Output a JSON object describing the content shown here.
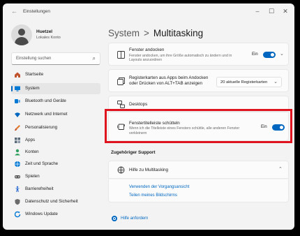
{
  "window": {
    "app_title": "Einstellungen",
    "back_icon": "arrow-left",
    "minimize_icon": "minimize",
    "maximize_icon": "maximize",
    "close_icon": "close"
  },
  "profile": {
    "name": "Huetzel",
    "account_type": "Lokales Konto"
  },
  "search": {
    "placeholder": "Einstellung suchen",
    "icon": "search"
  },
  "sidebar": {
    "items": [
      {
        "label": "Startseite",
        "icon": "home",
        "color": "#c0522d"
      },
      {
        "label": "System",
        "icon": "monitor",
        "color": "#0078d4",
        "selected": true
      },
      {
        "label": "Bluetooth und Geräte",
        "icon": "bluetooth",
        "color": "#0078d4"
      },
      {
        "label": "Netzwerk und Internet",
        "icon": "wifi",
        "color": "#0067c0"
      },
      {
        "label": "Personalisierung",
        "icon": "brush",
        "color": "#e07a2e"
      },
      {
        "label": "Apps",
        "icon": "apps",
        "color": "#5a6a7a"
      },
      {
        "label": "Konten",
        "icon": "person",
        "color": "#2e9e5e"
      },
      {
        "label": "Zeit und Sprache",
        "icon": "globe",
        "color": "#0078d4"
      },
      {
        "label": "Spielen",
        "icon": "gamepad",
        "color": "#5a5a5a"
      },
      {
        "label": "Barrierefreiheit",
        "icon": "accessibility",
        "color": "#2c6bd1"
      },
      {
        "label": "Datenschutz und Sicherheit",
        "icon": "shield",
        "color": "#6b6b6b"
      },
      {
        "label": "Windows Update",
        "icon": "update",
        "color": "#0078d4"
      }
    ]
  },
  "breadcrumb": {
    "parent": "System",
    "separator": ">",
    "current": "Multitasking"
  },
  "settings": {
    "snap": {
      "title": "Fenster andocken",
      "description_line1": "Fenster andocken, um ihre Größe automatisch zu ändern und in",
      "description_line2": "Layouts anzuordnen",
      "state": "Ein",
      "on": true
    },
    "tabs": {
      "title_line1": "Registerkarten aus Apps beim Andocken",
      "title_line2": "oder Drücken von ALT+TAB anzeigen",
      "value": "20 aktuelle Registerkarten"
    },
    "desktops": {
      "title": "Desktops"
    },
    "shake": {
      "title": "Fenstertitelleiste schütteln",
      "description_line1": "Wenn ich die Titelleiste eines Fensters schüttle, alle anderen Fenster",
      "description_line2": "verkleinern",
      "state": "Ein",
      "on": true
    }
  },
  "support": {
    "heading": "Zugehöriger Support",
    "title": "Hilfe zu Multitasking",
    "links": [
      "Verwenden der Vorgangsansicht",
      "Teilen meines Bildschirms"
    ]
  },
  "help": {
    "label": "Hilfe anfordern"
  },
  "colors": {
    "accent": "#0067c0",
    "highlight_border": "#e0141e"
  }
}
